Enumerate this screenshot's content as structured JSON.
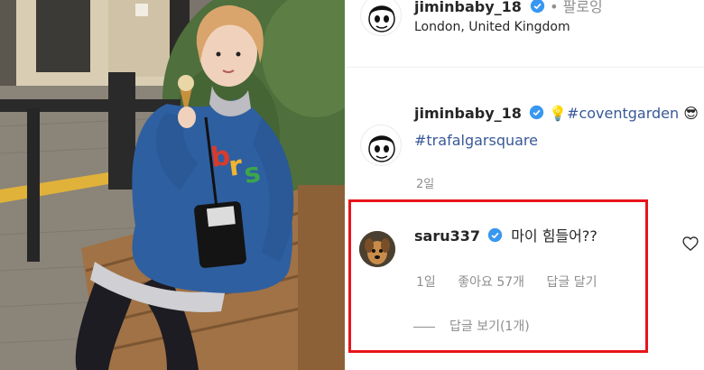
{
  "post": {
    "author": "jiminbaby_18",
    "follow_label": "• 팔로잉",
    "location": "London, United Kingdom",
    "caption": {
      "emoji_left": "💡",
      "hashtag1": "#coventgarden",
      "emoji_right": "😎",
      "hashtag2": "#trafalgarsquare"
    },
    "caption_time": "2일"
  },
  "comment": {
    "username": "saru337",
    "text": "마이 힘들어??",
    "time": "1일",
    "likes": "좋아요 57개",
    "reply_label": "답글 달기",
    "view_replies": "답글 보기(1개)"
  },
  "colors": {
    "highlight_border": "#e8141c",
    "verified_blue": "#3897f0",
    "hashtag": "#385898",
    "muted_text": "#8e8e8e"
  },
  "icons": [
    "verified-badge-icon",
    "heart-icon",
    "lightbulb-emoji",
    "sunglasses-emoji"
  ]
}
